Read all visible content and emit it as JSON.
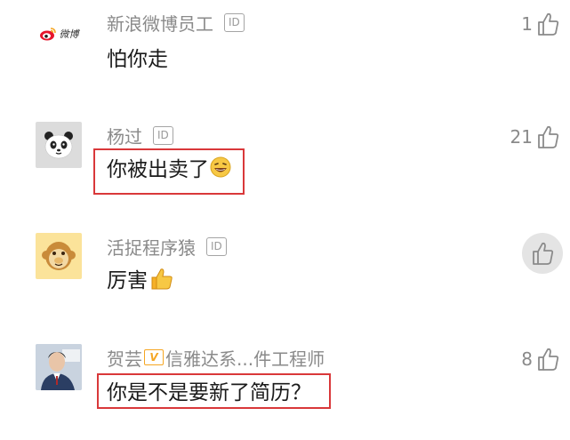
{
  "comments": [
    {
      "name": "新浪微博员工",
      "badge": "ID",
      "text": "怕你走",
      "likes": "1",
      "avatar": "weibo-logo",
      "avatar_text": "微博"
    },
    {
      "name": "杨过",
      "badge": "ID",
      "text": "你被出卖了",
      "emoji": "laughing-emoji",
      "likes": "21",
      "avatar": "panda-avatar",
      "highlighted": true
    },
    {
      "name": "活捉程序猿",
      "badge": "ID",
      "text": "厉害",
      "emoji": "thumbs-up-emoji",
      "likes": "",
      "avatar": "monkey-avatar",
      "like_pressed": true
    },
    {
      "name_prefix": "贺芸",
      "badge": "V",
      "name": "信雅达系...件工程师",
      "text": "你是不是要新了简历？",
      "likes": "8",
      "avatar": "person-photo-avatar",
      "highlighted": true
    }
  ],
  "colors": {
    "highlight": "#d9383a",
    "name": "#8a8a8a",
    "text": "#1a1a1a",
    "vip_badge": "#f5a623"
  }
}
